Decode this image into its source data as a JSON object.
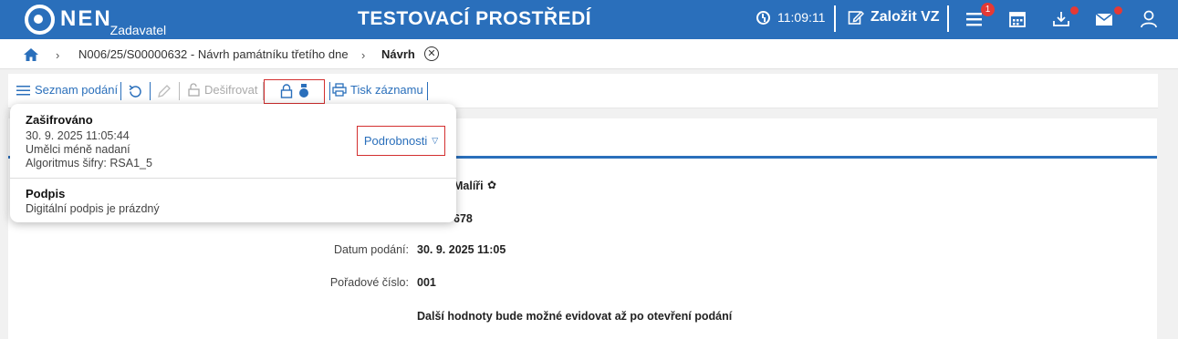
{
  "header": {
    "logo_text": "NEN",
    "logo_sub": "Zadavatel",
    "env_title": "TESTOVACÍ PROSTŘEDÍ",
    "time": "11:09:11",
    "create_label": "Založit VZ",
    "menu_badge": "1",
    "icons": [
      "clock-icon",
      "edit-icon",
      "menu-icon",
      "calendar-icon",
      "download-icon",
      "mail-icon",
      "user-icon"
    ]
  },
  "breadcrumb": {
    "items": [
      "N006/25/S00000632 - Návrh památníku třetího dne",
      "Návrh"
    ]
  },
  "toolbar": {
    "list_label": "Seznam podání",
    "decrypt_label": "Dešifrovat",
    "print_label": "Tisk záznamu"
  },
  "popup": {
    "encrypted_title": "Zašifrováno",
    "encrypted_date": "30. 9. 2025 11:05:44",
    "encrypted_author": "Umělci méně nadaní",
    "encrypted_algo": "Algoritmus šifry: RSA1_5",
    "details_label": "Podrobnosti",
    "signature_title": "Podpis",
    "signature_text": "Digitální podpis je prázdný"
  },
  "fields": {
    "partial_value_1": "Malíři",
    "partial_value_2": "678",
    "date_label": "Datum podání:",
    "date_value": "30. 9. 2025 11:05",
    "order_label": "Pořadové číslo:",
    "order_value": "001",
    "note": "Další hodnoty bude možné evidovat až po otevření podání"
  },
  "colors": {
    "primary": "#2a6fbb",
    "alert": "#e53935",
    "highlight": "#d32f2f"
  }
}
